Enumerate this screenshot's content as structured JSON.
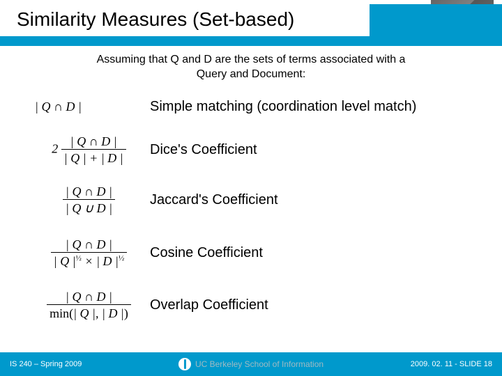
{
  "title": "Similarity Measures (Set-based)",
  "intro_line1": "Assuming that Q and D are the sets of terms associated with a",
  "intro_line2": "Query and Document:",
  "measures": [
    {
      "label": "Simple matching (coordination level match)"
    },
    {
      "label": "Dice's Coefficient"
    },
    {
      "label": "Jaccard's Coefficient"
    },
    {
      "label": "Cosine Coefficient"
    },
    {
      "label": "Overlap Coefficient"
    }
  ],
  "formulas": {
    "simple": "| Q ∩ D |",
    "dice_lead": "2",
    "intersect": "| Q ∩ D |",
    "dice_den": "| Q | + | D |",
    "jaccard_den": "| Q ∪ D |",
    "cosine_Q": "| Q |",
    "cosine_D": "| D |",
    "cosine_times": "×",
    "half": "½",
    "overlap_den_pre": "min(",
    "overlap_den_mid": "| Q |, | D |",
    "overlap_den_post": ")"
  },
  "footer": {
    "left": "IS 240 – Spring 2009",
    "center": "UC Berkeley School of Information",
    "right": "2009. 02. 11 - SLIDE 18"
  }
}
